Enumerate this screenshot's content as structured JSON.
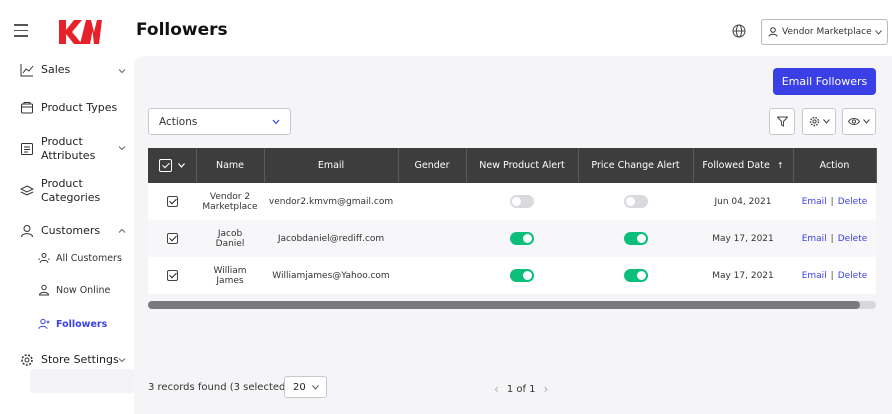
{
  "header": {
    "logo_text": "KM",
    "title": "Followers",
    "vendor_label": "Vendor Marketplace",
    "accent": "#3b3fe6",
    "logo_color": "#e8202a"
  },
  "sidebar": {
    "items": [
      {
        "label": "Sales",
        "icon": "chart-line-icon",
        "chevron": "down"
      },
      {
        "label": "Product Types",
        "icon": "folder-icon"
      },
      {
        "label": "Product Attributes",
        "icon": "list-icon",
        "chevron": "down"
      },
      {
        "label": "Product Categories",
        "icon": "layers-icon"
      },
      {
        "label": "Customers",
        "icon": "user-icon",
        "chevron": "up"
      },
      {
        "label": "Store Settings",
        "icon": "gear-icon",
        "chevron": "down"
      }
    ],
    "sub_items": [
      {
        "label": "All Customers",
        "icon": "users-icon"
      },
      {
        "label": "Now Online",
        "icon": "user-online-icon"
      },
      {
        "label": "Followers",
        "icon": "user-follow-icon",
        "active": true
      }
    ]
  },
  "toolbar": {
    "email_followers": "Email Followers",
    "actions_label": "Actions"
  },
  "table": {
    "columns": [
      "Name",
      "Email",
      "Gender",
      "New Product Alert",
      "Price Change Alert",
      "Followed Date",
      "Action"
    ],
    "sort_indicator": "↑",
    "rows": [
      {
        "name_line1": "Vendor 2",
        "name_line2": "Marketplace",
        "email": "vendor2.kmvm@gmail.com",
        "gender": "",
        "new_product_alert": false,
        "price_change_alert": false,
        "followed_date": "Jun 04, 2021",
        "checked": true
      },
      {
        "name_line1": "Jacob",
        "name_line2": "Daniel",
        "email": "Jacobdaniel@rediff.com",
        "gender": "",
        "new_product_alert": true,
        "price_change_alert": true,
        "followed_date": "May 17, 2021",
        "checked": true
      },
      {
        "name_line1": "William",
        "name_line2": "James",
        "email": "Williamjames@Yahoo.com",
        "gender": "",
        "new_product_alert": true,
        "price_change_alert": true,
        "followed_date": "May 17, 2021",
        "checked": true
      }
    ],
    "action_email": "Email",
    "action_separator": "|",
    "action_delete": "Delete"
  },
  "footer": {
    "records_text": "3 records found (3 selected)",
    "per_page": "20",
    "page_text": "1 of 1"
  }
}
